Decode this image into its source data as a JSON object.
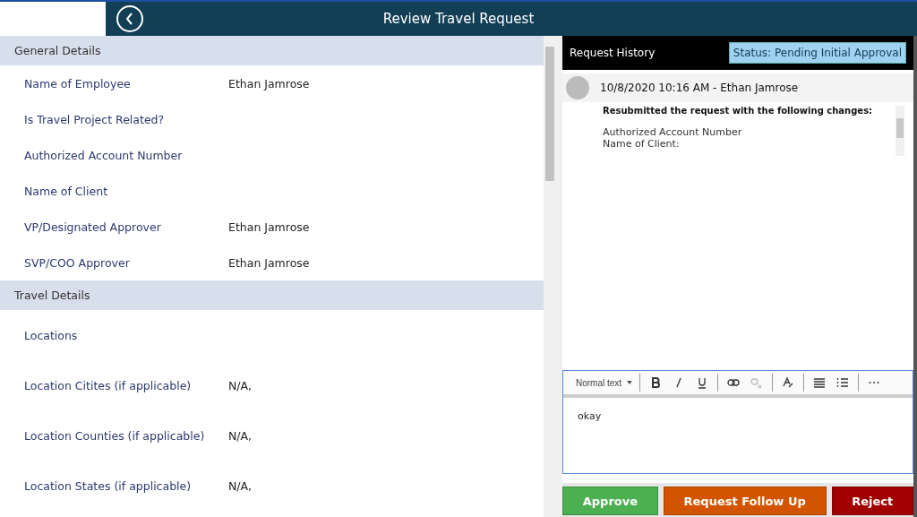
{
  "header": {
    "title": "Review Travel Request"
  },
  "sections": [
    {
      "title": "General Details",
      "rows": [
        {
          "label": "Name of Employee",
          "value": "Ethan Jamrose"
        },
        {
          "label": "Is Travel Project Related?"
        },
        {
          "label": "Authorized Account Number"
        },
        {
          "label": "Name of Client"
        },
        {
          "label": "VP/Designated Approver",
          "value": "Ethan Jamrose"
        },
        {
          "label": "SVP/COO Approver",
          "value": "Ethan Jamrose"
        }
      ]
    },
    {
      "title": "Travel Details",
      "rows": [
        {
          "label": "Locations"
        },
        {
          "label": "Location Citites (if applicable)",
          "value": "N/A,"
        },
        {
          "label": "Location Counties (if applicable)",
          "value": "N/A,"
        },
        {
          "label": "Location States (if applicable)",
          "value": "N/A,"
        }
      ]
    }
  ],
  "history": {
    "title": "Request History",
    "status": "Status: Pending Initial Approval",
    "entries": [
      {
        "meta": "10/8/2020 10:16 AM - Ethan Jamrose",
        "heading": "Resubmitted the request with the following changes:",
        "lines": [
          "Authorized Account Number",
          "Name of Client:"
        ]
      }
    ]
  },
  "editor": {
    "style": "Normal text",
    "value": "okay"
  },
  "actions": [
    {
      "label": "Approve",
      "color": "#4caf50"
    },
    {
      "label": "Request Follow Up",
      "color": "#d35400"
    },
    {
      "label": "Reject",
      "color": "#a00000"
    }
  ]
}
